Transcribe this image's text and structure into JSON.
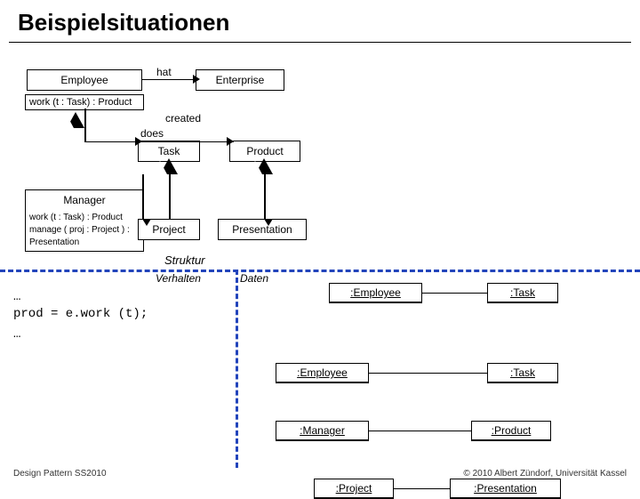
{
  "page": {
    "title": "Beispielsituationen"
  },
  "uml": {
    "employee_label": "Employee",
    "enterprise_label": "Enterprise",
    "work_product_label": "work (t : Task) : Product",
    "task_label": "Task",
    "product_label": "Product",
    "manager_label": "Manager",
    "work_manage_label": "work (t : Task) : Product\nmanage ( proj : Project ) : Presentation",
    "project_label": "Project",
    "presentation_label": "Presentation",
    "hat_label": "hat",
    "created_label": "created",
    "does_label": "does",
    "struktur_label": "Struktur",
    "verhalten_label": "Verhalten",
    "daten_label": "Daten"
  },
  "objects": {
    "employee1": ":Employee",
    "task1": ":Task",
    "employee2": ":Employee",
    "task2": ":Task",
    "manager1": ":Manager",
    "product1": ":Product",
    "project1": ":Project",
    "presentation1": ":Presentation"
  },
  "code": {
    "line1": "…",
    "line2": "prod = e.work (t);",
    "line3": "…"
  },
  "footer": {
    "left": "Design Pattern SS2010",
    "right": "© 2010 Albert Zündorf, Universität Kassel"
  }
}
